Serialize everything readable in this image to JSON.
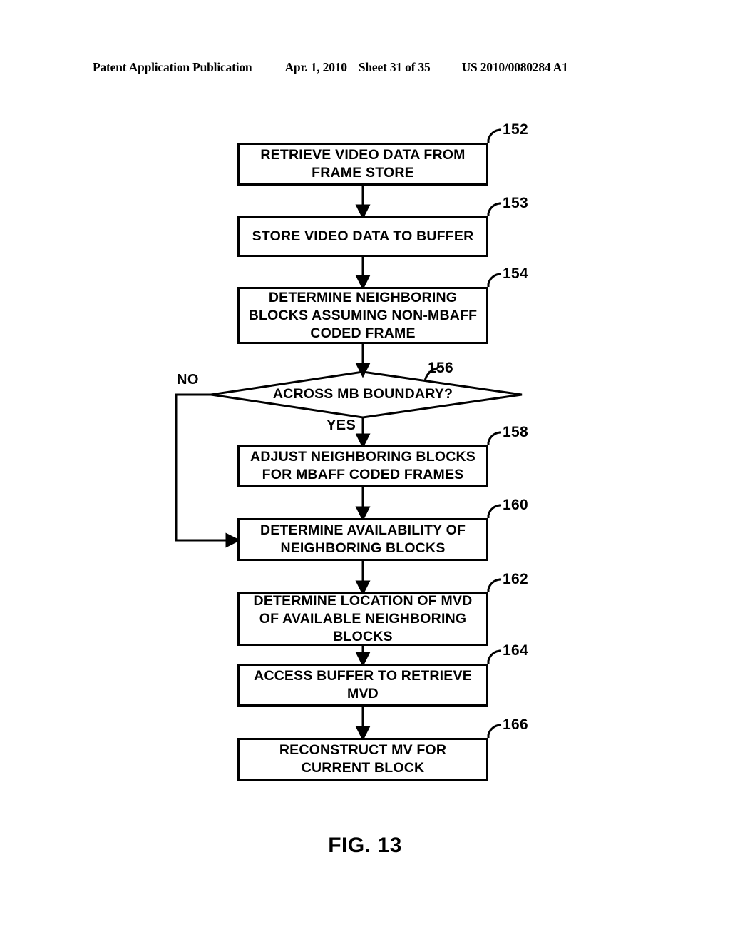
{
  "header": {
    "publication": "Patent Application Publication",
    "date": "Apr. 1, 2010",
    "sheet": "Sheet 31 of 35",
    "patent_number": "US 2010/0080284 A1"
  },
  "figure": {
    "caption": "FIG. 13"
  },
  "colors": {
    "line": "#000000",
    "background": "#ffffff",
    "text": "#000000"
  },
  "flowchart": {
    "type": "flowchart",
    "nodes": [
      {
        "id": "n152",
        "ref": "152",
        "shape": "process",
        "text": "RETRIEVE VIDEO DATA FROM FRAME STORE"
      },
      {
        "id": "n153",
        "ref": "153",
        "shape": "process",
        "text": "STORE VIDEO DATA TO BUFFER"
      },
      {
        "id": "n154",
        "ref": "154",
        "shape": "process",
        "text": "DETERMINE NEIGHBORING BLOCKS ASSUMING NON-MBAFF CODED FRAME"
      },
      {
        "id": "n156",
        "ref": "156",
        "shape": "decision",
        "text": "ACROSS MB BOUNDARY?"
      },
      {
        "id": "n158",
        "ref": "158",
        "shape": "process",
        "text": "ADJUST NEIGHBORING BLOCKS FOR MBAFF CODED FRAMES"
      },
      {
        "id": "n160",
        "ref": "160",
        "shape": "process",
        "text": "DETERMINE AVAILABILITY OF NEIGHBORING BLOCKS"
      },
      {
        "id": "n162",
        "ref": "162",
        "shape": "process",
        "text": "DETERMINE LOCATION OF MVD OF AVAILABLE NEIGHBORING BLOCKS"
      },
      {
        "id": "n164",
        "ref": "164",
        "shape": "process",
        "text": "ACCESS BUFFER TO RETRIEVE MVD"
      },
      {
        "id": "n166",
        "ref": "166",
        "shape": "process",
        "text": "RECONSTRUCT MV FOR CURRENT BLOCK"
      }
    ],
    "branch_labels": {
      "no": "NO",
      "yes": "YES"
    },
    "edges": [
      {
        "from": "n152",
        "to": "n153",
        "label": ""
      },
      {
        "from": "n153",
        "to": "n154",
        "label": ""
      },
      {
        "from": "n154",
        "to": "n156",
        "label": ""
      },
      {
        "from": "n156",
        "to": "n158",
        "label": "YES"
      },
      {
        "from": "n156",
        "to": "n160",
        "label": "NO"
      },
      {
        "from": "n158",
        "to": "n160",
        "label": ""
      },
      {
        "from": "n160",
        "to": "n162",
        "label": ""
      },
      {
        "from": "n162",
        "to": "n164",
        "label": ""
      },
      {
        "from": "n164",
        "to": "n166",
        "label": ""
      }
    ]
  }
}
